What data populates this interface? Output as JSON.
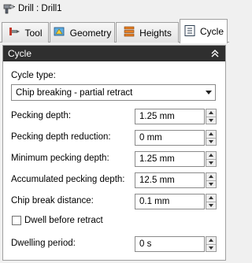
{
  "window": {
    "title": "Drill : Drill1",
    "icon": "drill-icon"
  },
  "tabs": [
    {
      "label": "Tool",
      "icon": "tool-icon",
      "active": false
    },
    {
      "label": "Geometry",
      "icon": "geometry-icon",
      "active": false
    },
    {
      "label": "Heights",
      "icon": "heights-icon",
      "active": false
    },
    {
      "label": "Cycle",
      "icon": "cycle-icon",
      "active": true
    }
  ],
  "panel": {
    "title": "Cycle",
    "collapse_icon": "double-chevron-up-icon"
  },
  "cycle_type": {
    "label": "Cycle type:",
    "value": "Chip breaking - partial retract"
  },
  "fields": [
    {
      "label": "Pecking depth:",
      "value": "1.25 mm"
    },
    {
      "label": "Pecking depth reduction:",
      "value": "0 mm"
    },
    {
      "label": "Minimum pecking depth:",
      "value": "1.25 mm"
    },
    {
      "label": "Accumulated pecking depth:",
      "value": "12.5 mm"
    },
    {
      "label": "Chip break distance:",
      "value": "0.1 mm"
    }
  ],
  "dwell": {
    "checkbox_label": "Dwell before retract",
    "checked": false,
    "period_label": "Dwelling period:",
    "period_value": "0 s"
  }
}
